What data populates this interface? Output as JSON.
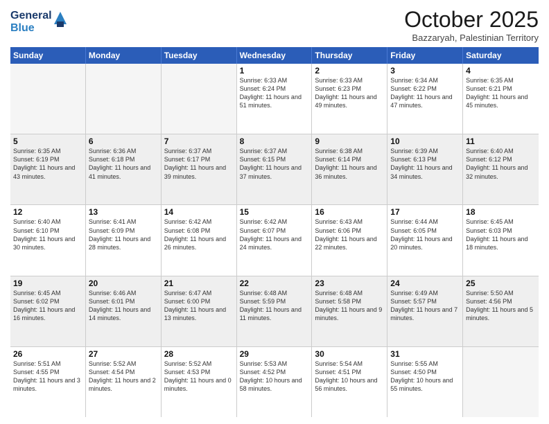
{
  "logo": {
    "general": "General",
    "blue": "Blue"
  },
  "header": {
    "month": "October 2025",
    "location": "Bazzaryah, Palestinian Territory"
  },
  "days": [
    "Sunday",
    "Monday",
    "Tuesday",
    "Wednesday",
    "Thursday",
    "Friday",
    "Saturday"
  ],
  "weeks": [
    [
      {
        "day": "",
        "empty": true
      },
      {
        "day": "",
        "empty": true
      },
      {
        "day": "",
        "empty": true
      },
      {
        "day": "1",
        "sunrise": "6:33 AM",
        "sunset": "6:24 PM",
        "daylight": "11 hours and 51 minutes."
      },
      {
        "day": "2",
        "sunrise": "6:33 AM",
        "sunset": "6:23 PM",
        "daylight": "11 hours and 49 minutes."
      },
      {
        "day": "3",
        "sunrise": "6:34 AM",
        "sunset": "6:22 PM",
        "daylight": "11 hours and 47 minutes."
      },
      {
        "day": "4",
        "sunrise": "6:35 AM",
        "sunset": "6:21 PM",
        "daylight": "11 hours and 45 minutes."
      }
    ],
    [
      {
        "day": "5",
        "sunrise": "6:35 AM",
        "sunset": "6:19 PM",
        "daylight": "11 hours and 43 minutes."
      },
      {
        "day": "6",
        "sunrise": "6:36 AM",
        "sunset": "6:18 PM",
        "daylight": "11 hours and 41 minutes."
      },
      {
        "day": "7",
        "sunrise": "6:37 AM",
        "sunset": "6:17 PM",
        "daylight": "11 hours and 39 minutes."
      },
      {
        "day": "8",
        "sunrise": "6:37 AM",
        "sunset": "6:15 PM",
        "daylight": "11 hours and 37 minutes."
      },
      {
        "day": "9",
        "sunrise": "6:38 AM",
        "sunset": "6:14 PM",
        "daylight": "11 hours and 36 minutes."
      },
      {
        "day": "10",
        "sunrise": "6:39 AM",
        "sunset": "6:13 PM",
        "daylight": "11 hours and 34 minutes."
      },
      {
        "day": "11",
        "sunrise": "6:40 AM",
        "sunset": "6:12 PM",
        "daylight": "11 hours and 32 minutes."
      }
    ],
    [
      {
        "day": "12",
        "sunrise": "6:40 AM",
        "sunset": "6:10 PM",
        "daylight": "11 hours and 30 minutes."
      },
      {
        "day": "13",
        "sunrise": "6:41 AM",
        "sunset": "6:09 PM",
        "daylight": "11 hours and 28 minutes."
      },
      {
        "day": "14",
        "sunrise": "6:42 AM",
        "sunset": "6:08 PM",
        "daylight": "11 hours and 26 minutes."
      },
      {
        "day": "15",
        "sunrise": "6:42 AM",
        "sunset": "6:07 PM",
        "daylight": "11 hours and 24 minutes."
      },
      {
        "day": "16",
        "sunrise": "6:43 AM",
        "sunset": "6:06 PM",
        "daylight": "11 hours and 22 minutes."
      },
      {
        "day": "17",
        "sunrise": "6:44 AM",
        "sunset": "6:05 PM",
        "daylight": "11 hours and 20 minutes."
      },
      {
        "day": "18",
        "sunrise": "6:45 AM",
        "sunset": "6:03 PM",
        "daylight": "11 hours and 18 minutes."
      }
    ],
    [
      {
        "day": "19",
        "sunrise": "6:45 AM",
        "sunset": "6:02 PM",
        "daylight": "11 hours and 16 minutes."
      },
      {
        "day": "20",
        "sunrise": "6:46 AM",
        "sunset": "6:01 PM",
        "daylight": "11 hours and 14 minutes."
      },
      {
        "day": "21",
        "sunrise": "6:47 AM",
        "sunset": "6:00 PM",
        "daylight": "11 hours and 13 minutes."
      },
      {
        "day": "22",
        "sunrise": "6:48 AM",
        "sunset": "5:59 PM",
        "daylight": "11 hours and 11 minutes."
      },
      {
        "day": "23",
        "sunrise": "6:48 AM",
        "sunset": "5:58 PM",
        "daylight": "11 hours and 9 minutes."
      },
      {
        "day": "24",
        "sunrise": "6:49 AM",
        "sunset": "5:57 PM",
        "daylight": "11 hours and 7 minutes."
      },
      {
        "day": "25",
        "sunrise": "5:50 AM",
        "sunset": "4:56 PM",
        "daylight": "11 hours and 5 minutes."
      }
    ],
    [
      {
        "day": "26",
        "sunrise": "5:51 AM",
        "sunset": "4:55 PM",
        "daylight": "11 hours and 3 minutes."
      },
      {
        "day": "27",
        "sunrise": "5:52 AM",
        "sunset": "4:54 PM",
        "daylight": "11 hours and 2 minutes."
      },
      {
        "day": "28",
        "sunrise": "5:52 AM",
        "sunset": "4:53 PM",
        "daylight": "11 hours and 0 minutes."
      },
      {
        "day": "29",
        "sunrise": "5:53 AM",
        "sunset": "4:52 PM",
        "daylight": "10 hours and 58 minutes."
      },
      {
        "day": "30",
        "sunrise": "5:54 AM",
        "sunset": "4:51 PM",
        "daylight": "10 hours and 56 minutes."
      },
      {
        "day": "31",
        "sunrise": "5:55 AM",
        "sunset": "4:50 PM",
        "daylight": "10 hours and 55 minutes."
      },
      {
        "day": "",
        "empty": true
      }
    ]
  ]
}
